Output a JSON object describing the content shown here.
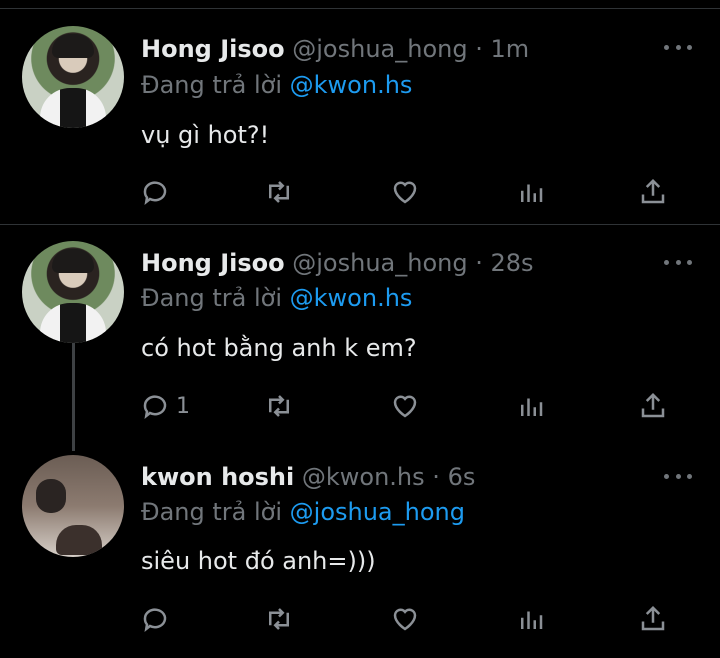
{
  "colors": {
    "background": "#000000",
    "name": "#e7e9ea",
    "muted": "#71767b",
    "mention": "#1d9bf0"
  },
  "tweets": [
    {
      "name": "Hong Jisoo",
      "handle": "@joshua_hong",
      "dot": "·",
      "time": "1m",
      "reply_prefix": "Đang trả lời",
      "reply_to": "@kwon.hs",
      "text": "vụ gì hot?!",
      "reply_count": ""
    },
    {
      "name": "Hong Jisoo",
      "handle": "@joshua_hong",
      "dot": "·",
      "time": "28s",
      "reply_prefix": "Đang trả lời",
      "reply_to": "@kwon.hs",
      "text": "có hot bằng anh k em?",
      "reply_count": "1"
    },
    {
      "name": "kwon hoshi",
      "handle": "@kwon.hs",
      "dot": "·",
      "time": "6s",
      "reply_prefix": "Đang trả lời",
      "reply_to": "@joshua_hong",
      "text": "siêu hot đó anh=)))",
      "reply_count": ""
    }
  ],
  "icons": [
    "reply-icon",
    "retweet-icon",
    "like-icon",
    "analytics-icon",
    "share-icon",
    "more-icon"
  ]
}
